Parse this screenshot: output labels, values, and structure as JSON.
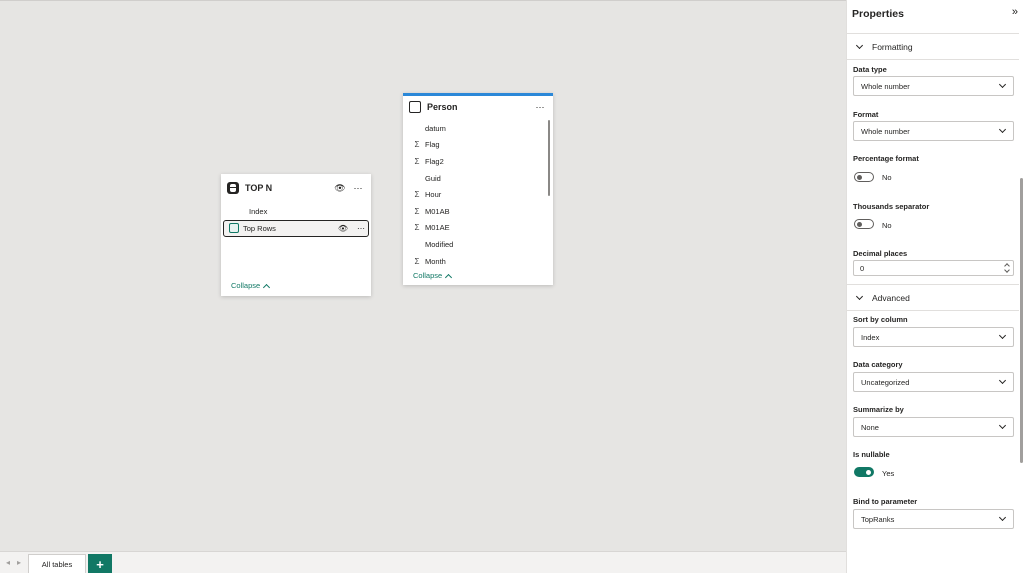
{
  "canvas": {
    "top_n_card": {
      "title": "TOP N",
      "rows": [
        {
          "label": "Index",
          "aggregate": false
        },
        {
          "label": "Top Rows",
          "selected": true
        }
      ],
      "collapse_label": "Collapse"
    },
    "person_card": {
      "title": "Person",
      "accent_color": "#2b88d8",
      "rows": [
        {
          "label": "datum",
          "aggregate": false
        },
        {
          "label": "Flag",
          "aggregate": true
        },
        {
          "label": "Flag2",
          "aggregate": true
        },
        {
          "label": "Guid",
          "aggregate": false
        },
        {
          "label": "Hour",
          "aggregate": true
        },
        {
          "label": "M01AB",
          "aggregate": true
        },
        {
          "label": "M01AE",
          "aggregate": true
        },
        {
          "label": "Modified",
          "aggregate": false
        },
        {
          "label": "Month",
          "aggregate": true
        }
      ],
      "collapse_label": "Collapse"
    }
  },
  "bottom_bar": {
    "tab_label": "All tables",
    "add_label": "+"
  },
  "properties": {
    "title": "Properties",
    "toggle_icon": "»",
    "formatting": {
      "header": "Formatting",
      "data_type_label": "Data type",
      "data_type_value": "Whole number",
      "format_label": "Format",
      "format_value": "Whole number",
      "percentage_label": "Percentage format",
      "percentage_value": "No",
      "thousands_label": "Thousands separator",
      "thousands_value": "No",
      "decimal_label": "Decimal places",
      "decimal_value": "0"
    },
    "advanced": {
      "header": "Advanced",
      "sort_label": "Sort by column",
      "sort_value": "Index",
      "category_label": "Data category",
      "category_value": "Uncategorized",
      "summarize_label": "Summarize by",
      "summarize_value": "None",
      "nullable_label": "Is nullable",
      "nullable_value": "Yes",
      "bind_label": "Bind to parameter",
      "bind_value": "TopRanks"
    }
  },
  "colors": {
    "accent": "#117865",
    "person_bar": "#2b88d8"
  }
}
